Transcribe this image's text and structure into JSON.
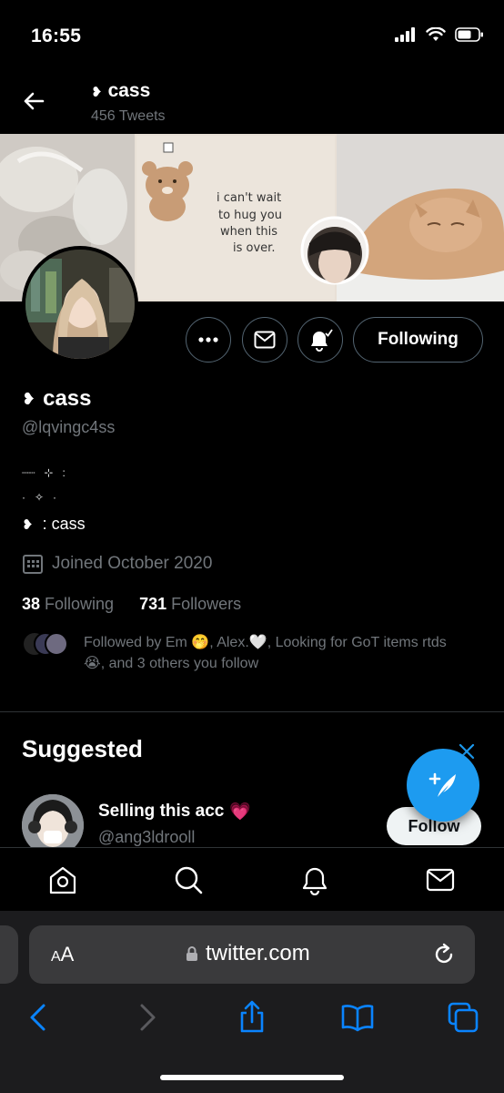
{
  "status_bar": {
    "time": "16:55"
  },
  "header": {
    "name": "cass",
    "tweet_count": "456 Tweets"
  },
  "banner": {
    "note_text": [
      "i can't wait",
      "to hug you",
      "when this",
      "is over."
    ]
  },
  "profile": {
    "name": "cass",
    "handle": "@lqvingc4ss",
    "following_button": "Following",
    "bio_line1": "┈┈   ⊹   :",
    "bio_line2": "·   ✧   ·",
    "bio_line3": ": cass",
    "joined": "Joined October 2020",
    "following_count": "38",
    "following_label": "Following",
    "followers_count": "731",
    "followers_label": "Followers",
    "followed_by": "Followed by Em 🤭, Alex.🤍, Looking for GoT items rtds 😭, and 3 others you follow"
  },
  "suggested": {
    "title": "Suggested",
    "user_name": "Selling this acc",
    "user_emoji": "💗",
    "user_handle": "@ang3ldrooll",
    "follow_label": "Follow"
  },
  "browser": {
    "aa_label": "AA",
    "url": "twitter.com"
  },
  "icons": {
    "tabbar": [
      "home-icon",
      "search-icon",
      "notifications-icon",
      "messages-icon"
    ],
    "safari": [
      "back-icon",
      "forward-icon",
      "share-icon",
      "bookmarks-icon",
      "tabs-icon"
    ]
  },
  "colors": {
    "accent": "#1d9bf0",
    "background": "#000000",
    "muted": "#71767b",
    "safari_accent": "#0a84ff"
  }
}
